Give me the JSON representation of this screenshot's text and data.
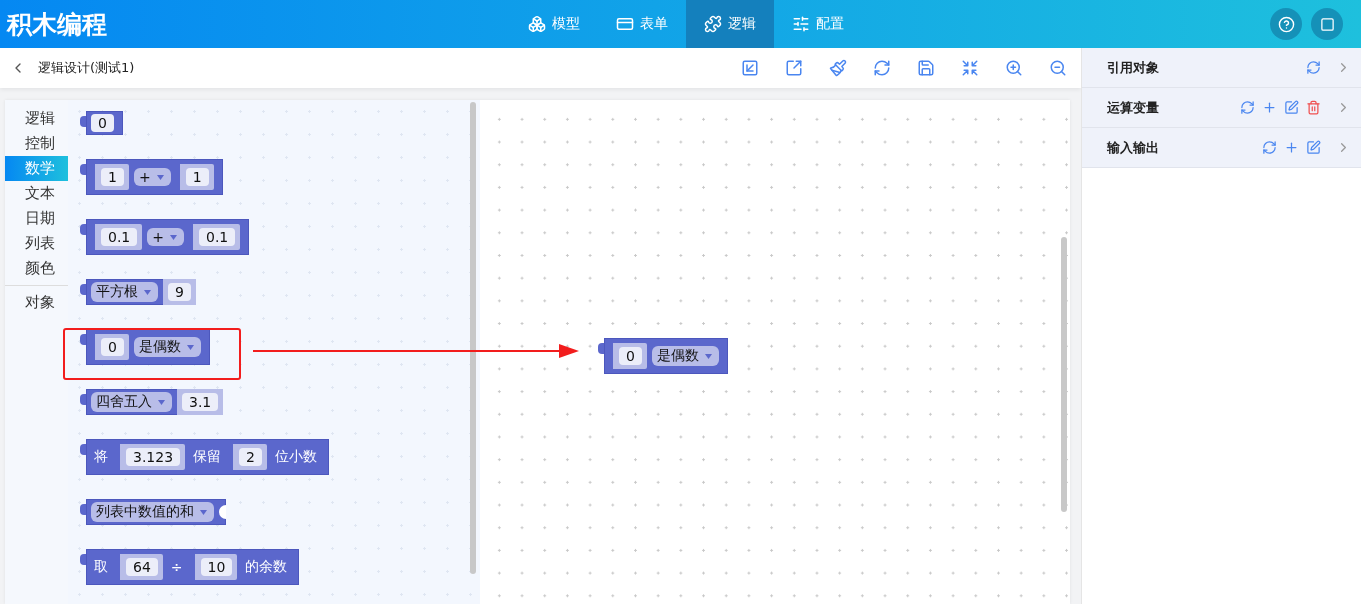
{
  "app": {
    "title": "积木编程"
  },
  "nav_tabs": [
    {
      "label": "模型",
      "kind": "model",
      "selected": false
    },
    {
      "label": "表单",
      "kind": "form",
      "selected": false
    },
    {
      "label": "逻辑",
      "kind": "logic",
      "selected": true
    },
    {
      "label": "配置",
      "kind": "config",
      "selected": false
    }
  ],
  "breadcrumb": {
    "title": "逻辑设计(测试1)"
  },
  "categories": [
    {
      "label": "逻辑",
      "selected": false
    },
    {
      "label": "控制",
      "selected": false
    },
    {
      "label": "数学",
      "selected": true
    },
    {
      "label": "文本",
      "selected": false
    },
    {
      "label": "日期",
      "selected": false
    },
    {
      "label": "列表",
      "selected": false
    },
    {
      "label": "颜色",
      "selected": false
    }
  ],
  "extra_categories": [
    {
      "label": "对象",
      "selected": false
    }
  ],
  "blocks": [
    {
      "parts": [
        {
          "kind": "field",
          "text": "0"
        }
      ]
    },
    {
      "parts": [
        {
          "kind": "input",
          "text": "1"
        },
        {
          "kind": "dropdown",
          "text": "+"
        },
        {
          "kind": "input",
          "text": "1"
        }
      ]
    },
    {
      "parts": [
        {
          "kind": "input",
          "text": "0.1"
        },
        {
          "kind": "dropdown",
          "text": "+"
        },
        {
          "kind": "input",
          "text": "0.1"
        }
      ]
    },
    {
      "parts": [
        {
          "kind": "dropdown",
          "text": "平方根"
        },
        {
          "kind": "value",
          "text": "9"
        }
      ]
    },
    {
      "parts": [
        {
          "kind": "input",
          "text": "0"
        },
        {
          "kind": "dropdown",
          "text": "是偶数"
        }
      ]
    },
    {
      "parts": [
        {
          "kind": "dropdown",
          "text": "四舍五入"
        },
        {
          "kind": "value",
          "text": "3.1"
        }
      ]
    },
    {
      "parts": [
        {
          "kind": "label",
          "text": "将"
        },
        {
          "kind": "input",
          "text": "3.123"
        },
        {
          "kind": "label",
          "text": "保留"
        },
        {
          "kind": "input",
          "text": "2"
        },
        {
          "kind": "label",
          "text": "位小数"
        }
      ]
    },
    {
      "parts": [
        {
          "kind": "dropdown",
          "text": "列表中数值的和"
        },
        {
          "kind": "socket"
        }
      ]
    },
    {
      "parts": [
        {
          "kind": "label",
          "text": "取"
        },
        {
          "kind": "input",
          "text": "64"
        },
        {
          "kind": "label",
          "text": "÷"
        },
        {
          "kind": "input",
          "text": "10"
        },
        {
          "kind": "label",
          "text": "的余数"
        }
      ]
    }
  ],
  "canvas_blocks": [
    {
      "parts": [
        {
          "kind": "input",
          "text": "0"
        },
        {
          "kind": "dropdown",
          "text": "是偶数"
        }
      ]
    }
  ],
  "right_panel": [
    {
      "title": "引用对象",
      "actions": [
        {
          "kind": "refresh"
        }
      ]
    },
    {
      "title": "运算变量",
      "actions": [
        {
          "kind": "refresh"
        },
        {
          "kind": "add"
        },
        {
          "kind": "edit"
        },
        {
          "kind": "delete"
        }
      ]
    },
    {
      "title": "输入输出",
      "actions": [
        {
          "kind": "refresh"
        },
        {
          "kind": "add"
        },
        {
          "kind": "edit"
        }
      ]
    }
  ]
}
